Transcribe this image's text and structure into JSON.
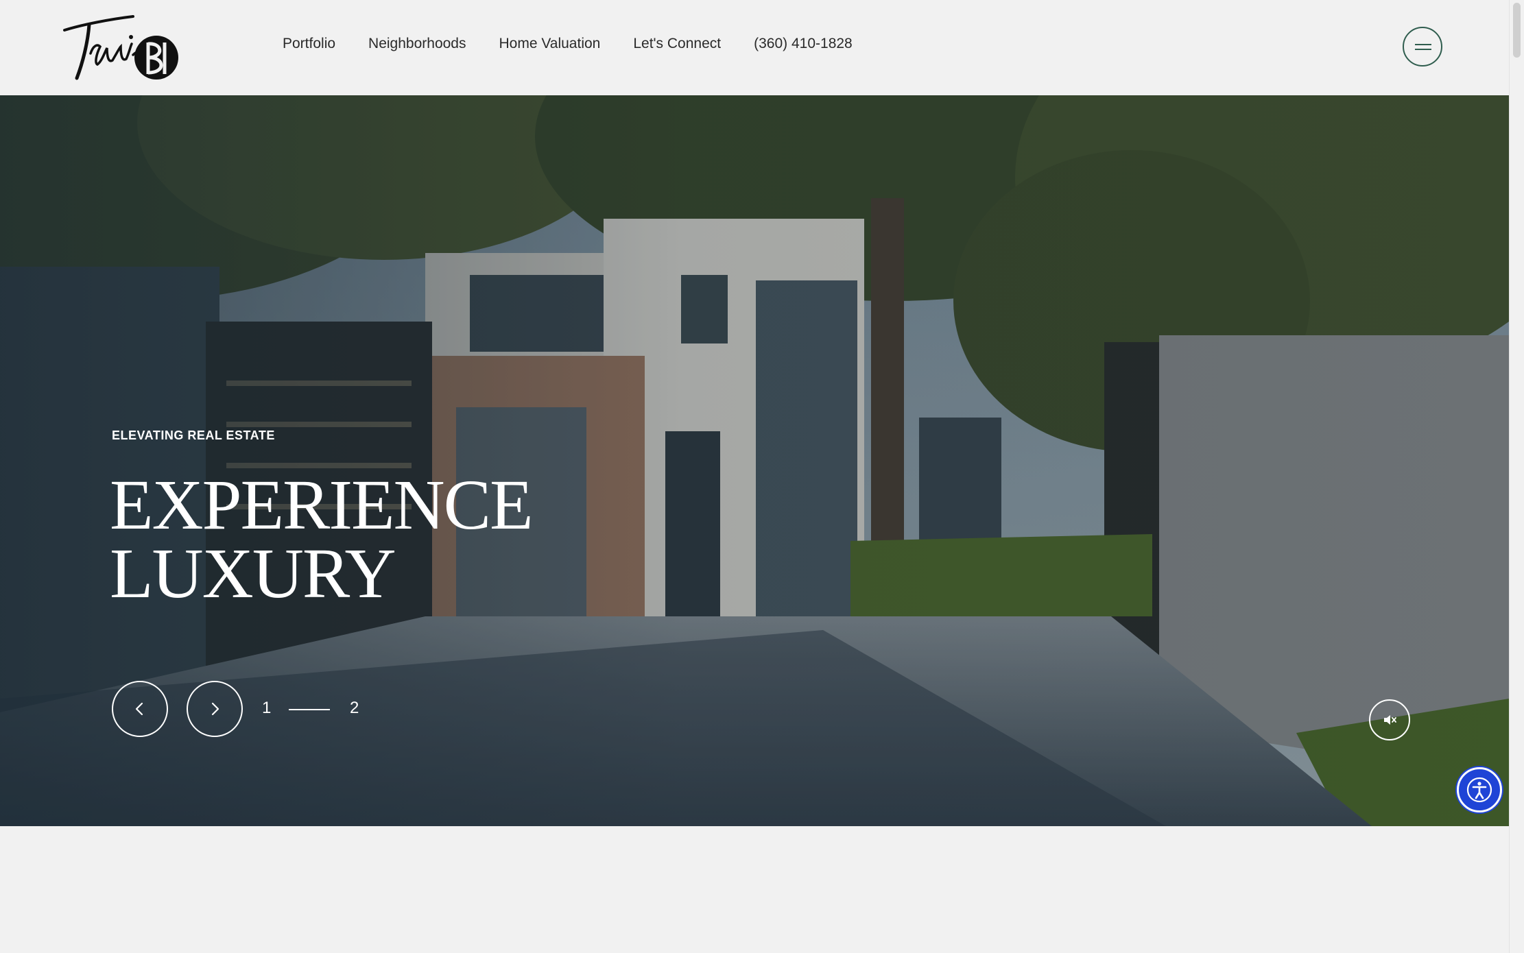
{
  "header": {
    "logo_text": "Travis",
    "nav": [
      {
        "label": "Portfolio"
      },
      {
        "label": "Neighborhoods"
      },
      {
        "label": "Home Valuation"
      },
      {
        "label": "Let's Connect"
      },
      {
        "label": "(360) 410-1828"
      }
    ],
    "menu_icon": "hamburger-icon",
    "menu_color": "#2f5d4e"
  },
  "hero": {
    "eyebrow": "ELEVATING REAL ESTATE",
    "headline_line1": "EXPERIENCE",
    "headline_line2": "LUXURY",
    "slider": {
      "prev_icon": "chevron-left-icon",
      "next_icon": "chevron-right-icon",
      "current": "1",
      "total": "2"
    },
    "mute_icon": "speaker-muted-icon"
  },
  "accessibility": {
    "icon": "accessibility-icon",
    "color": "#1f44d6"
  }
}
